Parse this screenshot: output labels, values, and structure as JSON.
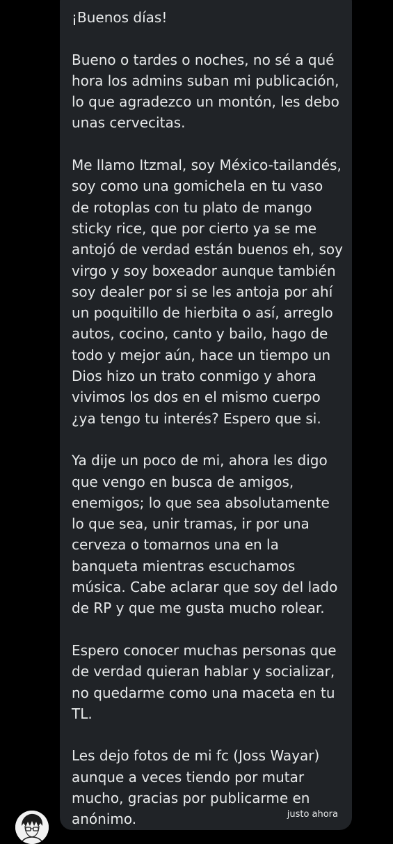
{
  "message": {
    "paragraphs": [
      "¡Buenos días!",
      "Bueno o tardes o noches, no sé a qué hora los admins suban mi publicación, lo que agradezco un montón, les debo unas cervecitas.",
      "Me llamo Itzmal, soy México-tailandés, soy como una gomichela en tu vaso de rotoplas con tu plato de mango sticky rice, que por cierto ya se me antojó de verdad están buenos eh, soy virgo y soy boxeador aunque también soy dealer por si se les antoja por ahí un poquitillo de hierbita o así, arreglo autos, cocino, canto y bailo, hago de todo y mejor aún, hace un tiempo un Dios hizo un trato conmigo y ahora vivimos los dos en el mismo cuerpo ¿ya tengo tu interés? Espero que si.",
      "Ya dije un poco de mi, ahora les digo que vengo en busca de amigos, enemigos; lo que sea absolutamente lo que sea, unir tramas, ir por una cerveza o tomarnos una en la banqueta mientras escuchamos música. Cabe aclarar que soy del lado de RP y que me gusta mucho rolear.",
      "Espero conocer muchas personas que de verdad quieran hablar y socializar, no quedarme como una maceta en tu TL.",
      "Les dejo fotos de mi fc (Joss Wayar) aunque a veces tiendo por mutar mucho, gracias por publicarme en anónimo."
    ],
    "timestamp": "justo ahora"
  },
  "sender": {
    "avatar_icon": "manga-portrait-avatar"
  },
  "colors": {
    "background": "#000000",
    "bubble": "#202327",
    "text": "#e7e9ea"
  }
}
